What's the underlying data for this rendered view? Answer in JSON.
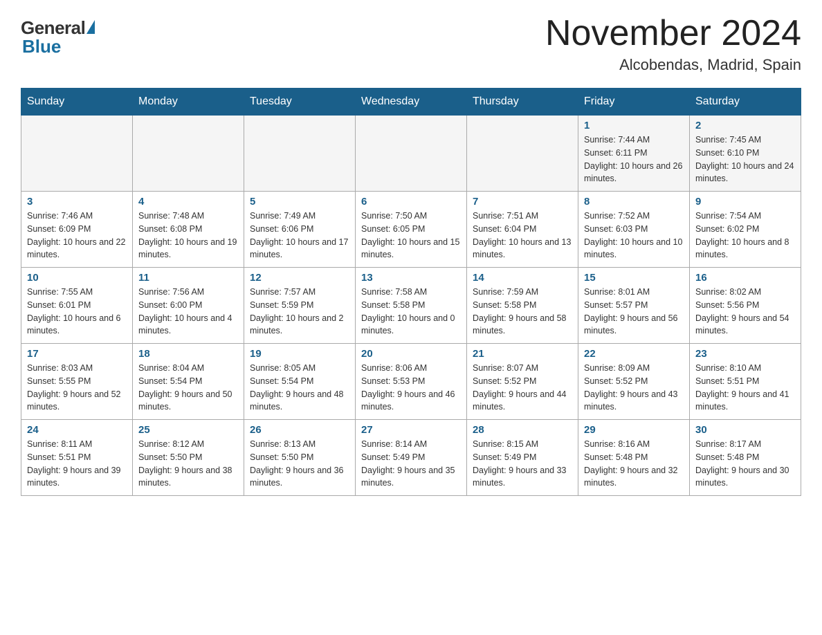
{
  "header": {
    "logo_general": "General",
    "logo_blue": "Blue",
    "month_title": "November 2024",
    "location": "Alcobendas, Madrid, Spain"
  },
  "weekdays": [
    "Sunday",
    "Monday",
    "Tuesday",
    "Wednesday",
    "Thursday",
    "Friday",
    "Saturday"
  ],
  "weeks": [
    [
      {
        "day": "",
        "info": ""
      },
      {
        "day": "",
        "info": ""
      },
      {
        "day": "",
        "info": ""
      },
      {
        "day": "",
        "info": ""
      },
      {
        "day": "",
        "info": ""
      },
      {
        "day": "1",
        "info": "Sunrise: 7:44 AM\nSunset: 6:11 PM\nDaylight: 10 hours and 26 minutes."
      },
      {
        "day": "2",
        "info": "Sunrise: 7:45 AM\nSunset: 6:10 PM\nDaylight: 10 hours and 24 minutes."
      }
    ],
    [
      {
        "day": "3",
        "info": "Sunrise: 7:46 AM\nSunset: 6:09 PM\nDaylight: 10 hours and 22 minutes."
      },
      {
        "day": "4",
        "info": "Sunrise: 7:48 AM\nSunset: 6:08 PM\nDaylight: 10 hours and 19 minutes."
      },
      {
        "day": "5",
        "info": "Sunrise: 7:49 AM\nSunset: 6:06 PM\nDaylight: 10 hours and 17 minutes."
      },
      {
        "day": "6",
        "info": "Sunrise: 7:50 AM\nSunset: 6:05 PM\nDaylight: 10 hours and 15 minutes."
      },
      {
        "day": "7",
        "info": "Sunrise: 7:51 AM\nSunset: 6:04 PM\nDaylight: 10 hours and 13 minutes."
      },
      {
        "day": "8",
        "info": "Sunrise: 7:52 AM\nSunset: 6:03 PM\nDaylight: 10 hours and 10 minutes."
      },
      {
        "day": "9",
        "info": "Sunrise: 7:54 AM\nSunset: 6:02 PM\nDaylight: 10 hours and 8 minutes."
      }
    ],
    [
      {
        "day": "10",
        "info": "Sunrise: 7:55 AM\nSunset: 6:01 PM\nDaylight: 10 hours and 6 minutes."
      },
      {
        "day": "11",
        "info": "Sunrise: 7:56 AM\nSunset: 6:00 PM\nDaylight: 10 hours and 4 minutes."
      },
      {
        "day": "12",
        "info": "Sunrise: 7:57 AM\nSunset: 5:59 PM\nDaylight: 10 hours and 2 minutes."
      },
      {
        "day": "13",
        "info": "Sunrise: 7:58 AM\nSunset: 5:58 PM\nDaylight: 10 hours and 0 minutes."
      },
      {
        "day": "14",
        "info": "Sunrise: 7:59 AM\nSunset: 5:58 PM\nDaylight: 9 hours and 58 minutes."
      },
      {
        "day": "15",
        "info": "Sunrise: 8:01 AM\nSunset: 5:57 PM\nDaylight: 9 hours and 56 minutes."
      },
      {
        "day": "16",
        "info": "Sunrise: 8:02 AM\nSunset: 5:56 PM\nDaylight: 9 hours and 54 minutes."
      }
    ],
    [
      {
        "day": "17",
        "info": "Sunrise: 8:03 AM\nSunset: 5:55 PM\nDaylight: 9 hours and 52 minutes."
      },
      {
        "day": "18",
        "info": "Sunrise: 8:04 AM\nSunset: 5:54 PM\nDaylight: 9 hours and 50 minutes."
      },
      {
        "day": "19",
        "info": "Sunrise: 8:05 AM\nSunset: 5:54 PM\nDaylight: 9 hours and 48 minutes."
      },
      {
        "day": "20",
        "info": "Sunrise: 8:06 AM\nSunset: 5:53 PM\nDaylight: 9 hours and 46 minutes."
      },
      {
        "day": "21",
        "info": "Sunrise: 8:07 AM\nSunset: 5:52 PM\nDaylight: 9 hours and 44 minutes."
      },
      {
        "day": "22",
        "info": "Sunrise: 8:09 AM\nSunset: 5:52 PM\nDaylight: 9 hours and 43 minutes."
      },
      {
        "day": "23",
        "info": "Sunrise: 8:10 AM\nSunset: 5:51 PM\nDaylight: 9 hours and 41 minutes."
      }
    ],
    [
      {
        "day": "24",
        "info": "Sunrise: 8:11 AM\nSunset: 5:51 PM\nDaylight: 9 hours and 39 minutes."
      },
      {
        "day": "25",
        "info": "Sunrise: 8:12 AM\nSunset: 5:50 PM\nDaylight: 9 hours and 38 minutes."
      },
      {
        "day": "26",
        "info": "Sunrise: 8:13 AM\nSunset: 5:50 PM\nDaylight: 9 hours and 36 minutes."
      },
      {
        "day": "27",
        "info": "Sunrise: 8:14 AM\nSunset: 5:49 PM\nDaylight: 9 hours and 35 minutes."
      },
      {
        "day": "28",
        "info": "Sunrise: 8:15 AM\nSunset: 5:49 PM\nDaylight: 9 hours and 33 minutes."
      },
      {
        "day": "29",
        "info": "Sunrise: 8:16 AM\nSunset: 5:48 PM\nDaylight: 9 hours and 32 minutes."
      },
      {
        "day": "30",
        "info": "Sunrise: 8:17 AM\nSunset: 5:48 PM\nDaylight: 9 hours and 30 minutes."
      }
    ]
  ]
}
